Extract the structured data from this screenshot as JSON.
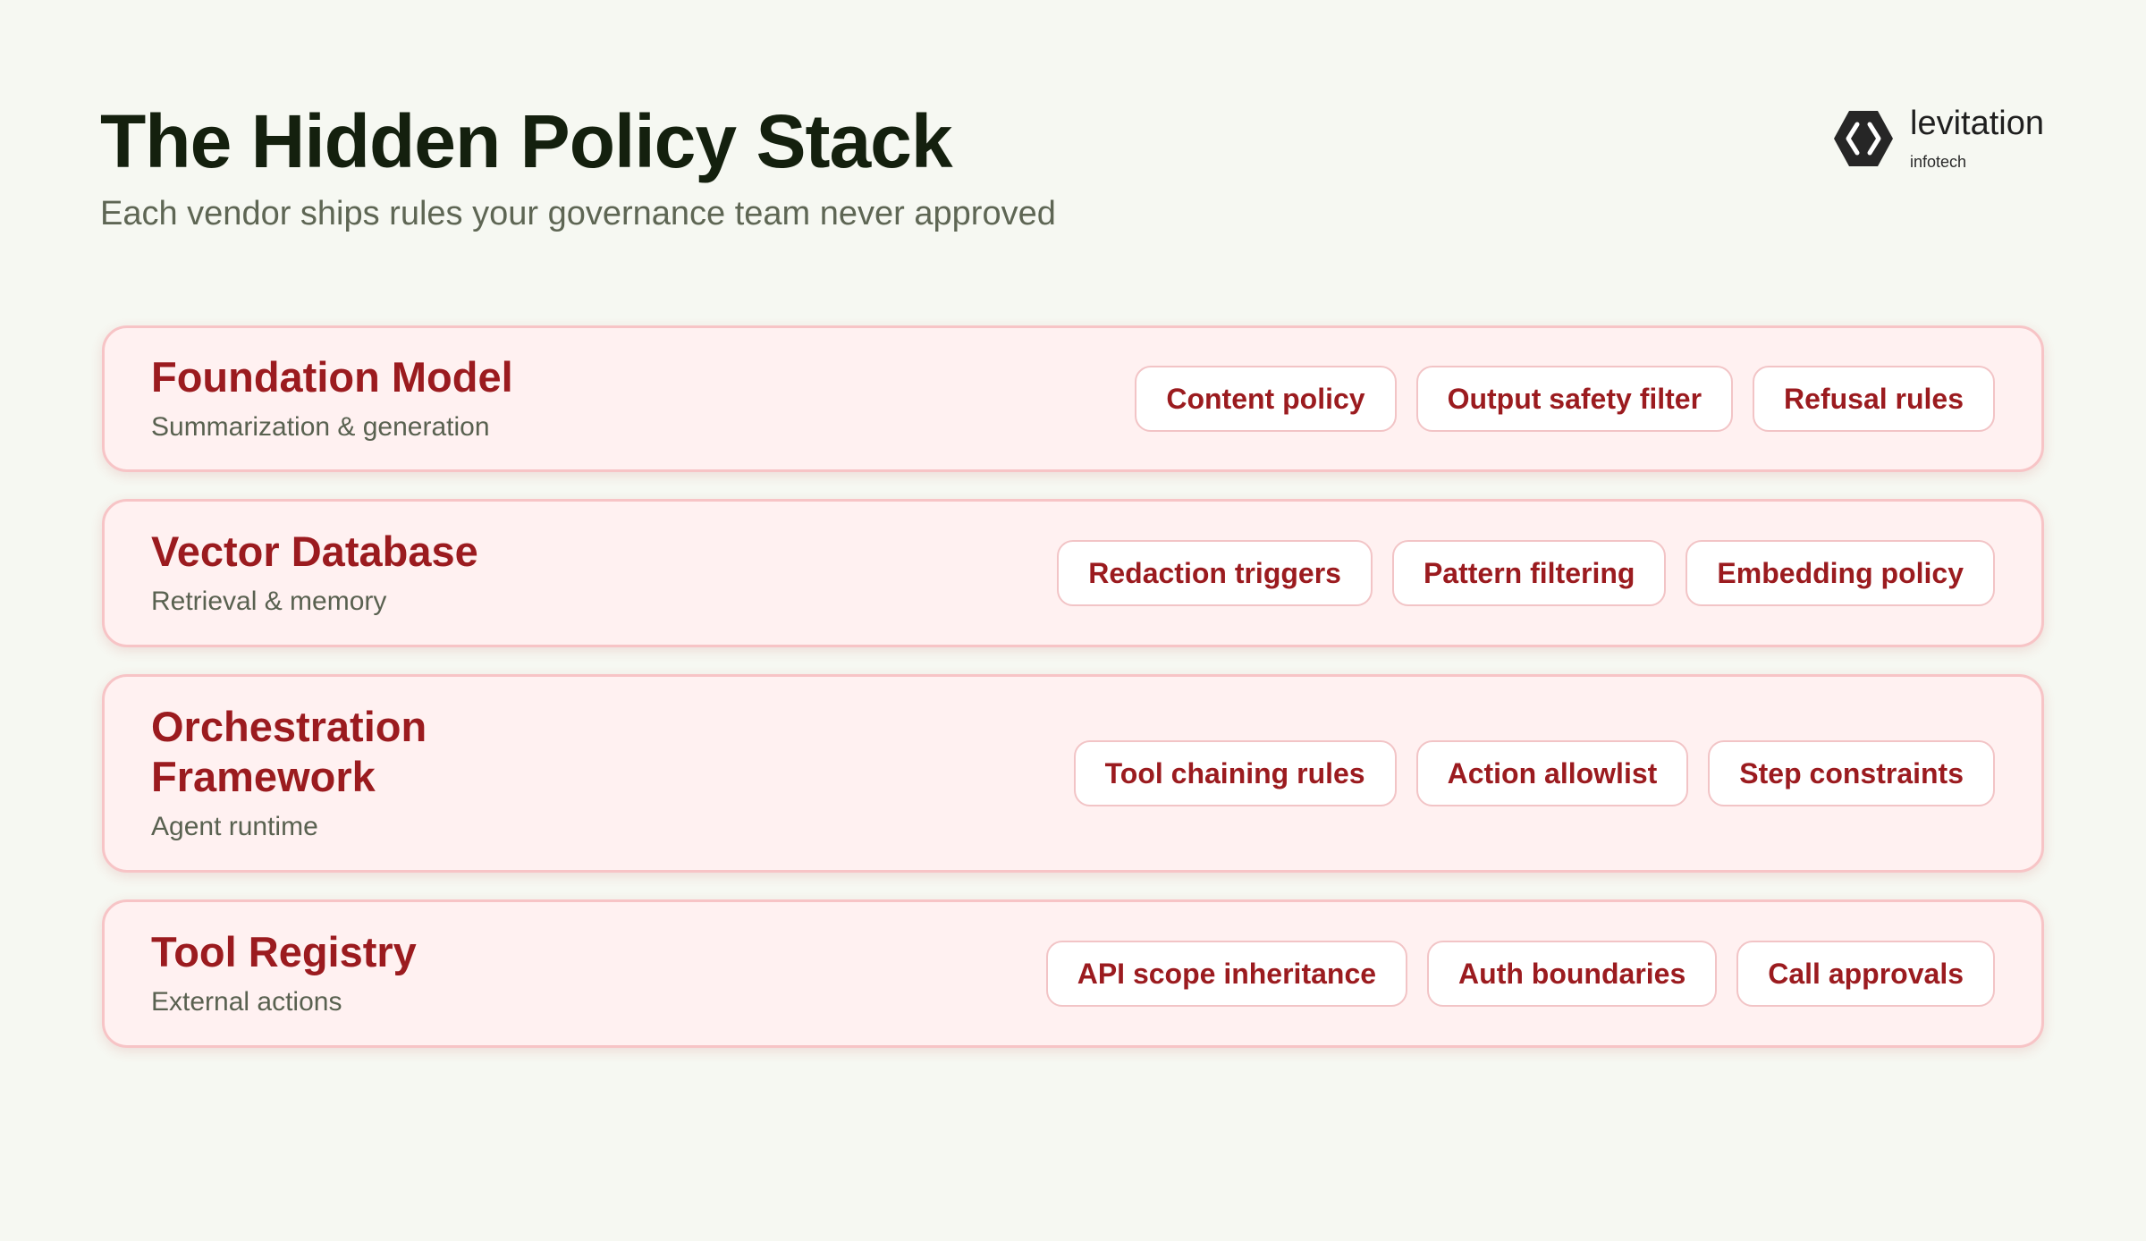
{
  "header": {
    "title": "The Hidden Policy Stack",
    "subtitle": "Each vendor ships rules your governance team never approved"
  },
  "logo": {
    "name": "levitation",
    "sub": "infotech",
    "icon": "hexagon-brackets-icon"
  },
  "colors": {
    "background": "#f6f8f2",
    "title": "#14200e",
    "accent": "#9b1b1f",
    "card_bg": "#fff1f1",
    "card_border": "#f7c4c6"
  },
  "layers": [
    {
      "title": "Foundation Model",
      "description": "Summarization & generation",
      "tags": [
        "Content policy",
        "Output safety filter",
        "Refusal rules"
      ]
    },
    {
      "title": "Vector Database",
      "description": "Retrieval & memory",
      "tags": [
        "Redaction triggers",
        "Pattern filtering",
        "Embedding policy"
      ]
    },
    {
      "title": "Orchestration Framework",
      "description": "Agent runtime",
      "tags": [
        "Tool chaining rules",
        "Action allowlist",
        "Step constraints"
      ]
    },
    {
      "title": "Tool Registry",
      "description": "External actions",
      "tags": [
        "API scope inheritance",
        "Auth boundaries",
        "Call approvals"
      ]
    }
  ]
}
